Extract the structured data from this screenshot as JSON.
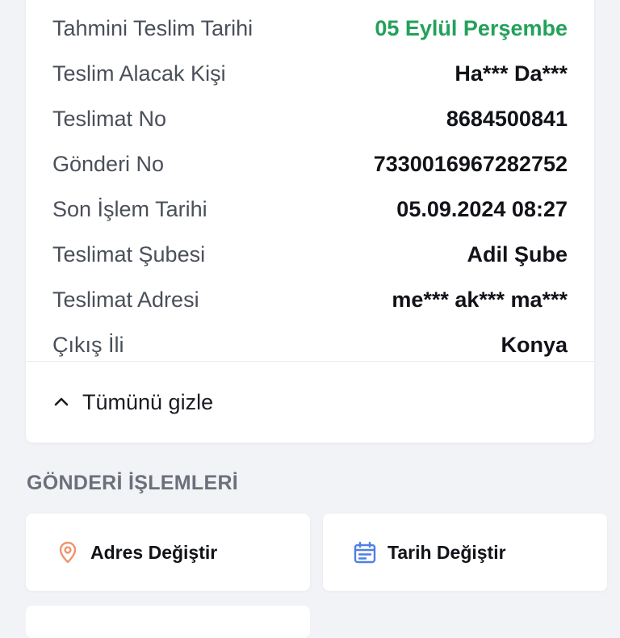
{
  "details": {
    "rows": [
      {
        "label": "Tahmini Teslim Tarihi",
        "value": "05 Eylül Perşembe"
      },
      {
        "label": "Teslim Alacak Kişi",
        "value": "Ha*** Da***"
      },
      {
        "label": "Teslimat No",
        "value": "8684500841"
      },
      {
        "label": "Gönderi No",
        "value": "7330016967282752"
      },
      {
        "label": "Son İşlem Tarihi",
        "value": "05.09.2024 08:27"
      },
      {
        "label": "Teslimat Şubesi",
        "value": "Adil Şube"
      },
      {
        "label": "Teslimat Adresi",
        "value": "me*** ak*** ma***"
      },
      {
        "label": "Çıkış İli",
        "value": "Konya"
      }
    ],
    "toggle_label": "Tümünü gizle",
    "toggle_icon": "chevron-up-icon"
  },
  "operations": {
    "title": "GÖNDERİ İŞLEMLERİ",
    "actions": [
      {
        "label": "Adres Değiştir",
        "icon": "location-pin-icon"
      },
      {
        "label": "Tarih Değiştir",
        "icon": "calendar-icon"
      }
    ]
  },
  "colors": {
    "accent_green": "#23a15a",
    "pin_orange": "#f0926a",
    "calendar_blue": "#4f7fe6"
  }
}
